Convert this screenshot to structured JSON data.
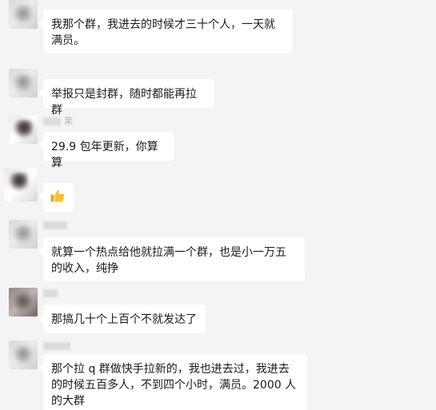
{
  "messages": [
    {
      "text": "我那个群，我进去的时候才三十个人，一天就满员。",
      "sender": ""
    },
    {
      "text": "举报只是封群，随时都能再拉群",
      "sender": ""
    },
    {
      "text": "29.9 包年更新，你算算",
      "sender": "茉"
    },
    {
      "text": "",
      "sender": "",
      "icon": "thumbs-up-icon"
    },
    {
      "text": "就算一个热点给他就拉满一个群，也是小一万五的收入，纯挣",
      "sender": ""
    },
    {
      "text": "那搞几十个上百个不就发达了",
      "sender": ""
    },
    {
      "text": "那个拉 q 群做快手拉新的，我也进去过，我进去的时候五百多人，不到四个小时，满员。2000 人的大群",
      "sender": ""
    }
  ],
  "colors": {
    "background": "#f4f4f4",
    "bubble": "#ffffff",
    "text": "#1a1a1a",
    "sender": "#b0b0b0"
  }
}
